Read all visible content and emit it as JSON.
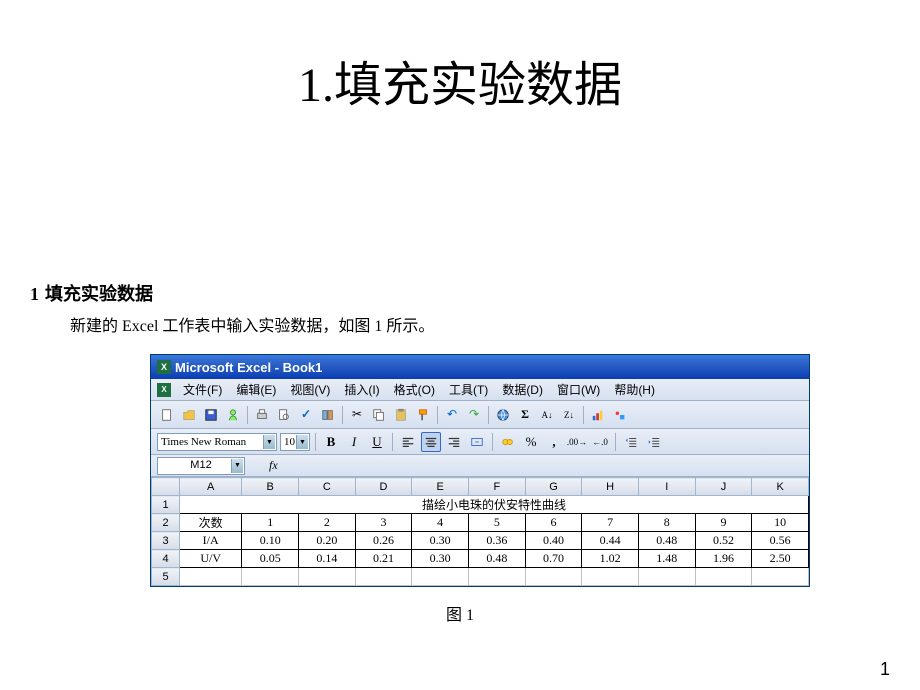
{
  "slide": {
    "title_num": "1.",
    "title_text": "填充实验数据",
    "page_number": "1"
  },
  "section": {
    "num": "1",
    "heading": "填充实验数据",
    "desc": "新建的 Excel 工作表中输入实验数据，如图 1 所示。"
  },
  "excel": {
    "title": "Microsoft Excel - Book1",
    "menus": {
      "file": "文件(F)",
      "edit": "编辑(E)",
      "view": "视图(V)",
      "insert": "插入(I)",
      "format": "格式(O)",
      "tools": "工具(T)",
      "data": "数据(D)",
      "window": "窗口(W)",
      "help": "帮助(H)"
    },
    "font_name": "Times New Roman",
    "font_size": "10",
    "name_box": "M12",
    "fx_label": "fx",
    "col_headers": [
      "A",
      "B",
      "C",
      "D",
      "E",
      "F",
      "G",
      "H",
      "I",
      "J",
      "K"
    ],
    "row_headers": [
      "1",
      "2",
      "3",
      "4",
      "5"
    ],
    "merged_title": "描绘小电珠的伏安特性曲线",
    "row2_label": "次数",
    "row3_label": "I/A",
    "row4_label": "U/V"
  },
  "chart_data": {
    "type": "table",
    "title": "描绘小电珠的伏安特性曲线",
    "columns": [
      "次数",
      "1",
      "2",
      "3",
      "4",
      "5",
      "6",
      "7",
      "8",
      "9",
      "10"
    ],
    "series": [
      {
        "name": "I/A",
        "values": [
          "0.10",
          "0.20",
          "0.26",
          "0.30",
          "0.36",
          "0.40",
          "0.44",
          "0.48",
          "0.52",
          "0.56"
        ]
      },
      {
        "name": "U/V",
        "values": [
          "0.05",
          "0.14",
          "0.21",
          "0.30",
          "0.48",
          "0.70",
          "1.02",
          "1.48",
          "1.96",
          "2.50"
        ]
      }
    ]
  },
  "fig_caption": "图 1"
}
